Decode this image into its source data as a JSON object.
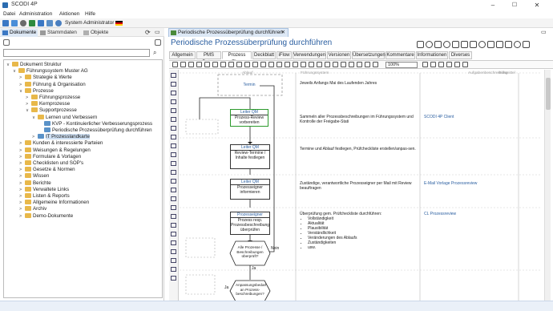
{
  "window": {
    "title": "SCODI 4P",
    "min": "–",
    "max": "☐",
    "close": "✕"
  },
  "menu": [
    "Datei",
    "Administration",
    "Aktionen",
    "Hilfe"
  ],
  "toolbar": {
    "user": "System Administrator"
  },
  "left": {
    "tabs": [
      "Dokumente",
      "Stammdaten",
      "Objekte"
    ],
    "search_placeholder": "",
    "tree": [
      {
        "label": "Dokument Struktur",
        "level": 0,
        "arrow": "∨",
        "type": "folder"
      },
      {
        "label": "Führungssystem Muster AG",
        "level": 1,
        "arrow": "∨",
        "type": "folder"
      },
      {
        "label": "Strategie & Werte",
        "level": 2,
        "arrow": ">",
        "type": "folder"
      },
      {
        "label": "Führung & Organisation",
        "level": 2,
        "arrow": ">",
        "type": "folder"
      },
      {
        "label": "Prozesse",
        "level": 2,
        "arrow": "∨",
        "type": "folder"
      },
      {
        "label": "Führungsprozesse",
        "level": 3,
        "arrow": ">",
        "type": "folder"
      },
      {
        "label": "Kernprozesse",
        "level": 3,
        "arrow": ">",
        "type": "folder"
      },
      {
        "label": "Supportprozesse",
        "level": 3,
        "arrow": "∨",
        "type": "folder"
      },
      {
        "label": "Lernen und Verbessern",
        "level": 4,
        "arrow": "∨",
        "type": "folder"
      },
      {
        "label": "KVP - Kontinuierlicher Verbesserungsprozess",
        "level": 5,
        "arrow": "",
        "type": "proc"
      },
      {
        "label": "Periodische Prozessüberprüfung durchführen",
        "level": 5,
        "arrow": "",
        "type": "proc"
      },
      {
        "label": "IT Prozesslandkarte",
        "level": 4,
        "arrow": ">",
        "type": "proc",
        "selected": true
      },
      {
        "label": "Kunden & interessierte Parteien",
        "level": 2,
        "arrow": ">",
        "type": "folder"
      },
      {
        "label": "Weisungen & Regelungen",
        "level": 2,
        "arrow": ">",
        "type": "folder"
      },
      {
        "label": "Formulare & Vorlagen",
        "level": 2,
        "arrow": ">",
        "type": "folder"
      },
      {
        "label": "Checklisten und SOP's",
        "level": 2,
        "arrow": ">",
        "type": "folder"
      },
      {
        "label": "Gesetze & Normen",
        "level": 2,
        "arrow": ">",
        "type": "folder"
      },
      {
        "label": "Wissen",
        "level": 2,
        "arrow": ">",
        "type": "folder"
      },
      {
        "label": "Berichte",
        "level": 2,
        "arrow": ">",
        "type": "folder"
      },
      {
        "label": "Verwaltete Links",
        "level": 2,
        "arrow": ">",
        "type": "folder"
      },
      {
        "label": "Listen & Reports",
        "level": 2,
        "arrow": ">",
        "type": "folder"
      },
      {
        "label": "Allgemeine Informationen",
        "level": 2,
        "arrow": ">",
        "type": "folder"
      },
      {
        "label": "Archiv",
        "level": 2,
        "arrow": ">",
        "type": "folder"
      },
      {
        "label": "Demo-Dokumente",
        "level": 2,
        "arrow": ">",
        "type": "folder"
      }
    ]
  },
  "right": {
    "doc_tab": "Periodische Prozessüberprüfung durchführen",
    "doc_title": "Periodische Prozessüberprüfung durchführen",
    "subtabs": [
      "Allgemein",
      "PMS Daten",
      "Prozess Flow",
      "Deckblatt",
      "iFlow",
      "Verwendungen",
      "Versionen",
      "Übersetzungen",
      "Kommentare",
      "Informationen",
      "Diverses"
    ],
    "active_subtab": "Prozess Flow",
    "zoom": "100%",
    "columns": [
      "Ablauf",
      "Führungssystem",
      "Aufgabenbeschreibung",
      "Hilfsmittel"
    ],
    "flow": {
      "start": "Termin",
      "steps": [
        {
          "role": "Leiter QM",
          "text": "Prozess-Review vorbereiten",
          "desc": "Sammeln aller Prozessbeschreibungen im Führungssystem und Kontrolle der Freigabe-Stati",
          "tool": "SCODI 4P Client"
        },
        {
          "role": "Leiter QM",
          "text": "Review-Termine / Inhalte festlegen",
          "desc": "Termine und Ablauf festlegen, Prüfcheckliste erstellen/anpas-sen.",
          "tool": ""
        },
        {
          "role": "Leiter QM",
          "text": "Prozesseigner informieren",
          "desc": "Zuständige, verantwortliche Prozesseigner per Mail mit Review beauftragen",
          "tool": "E-Mail Vorlage Prozessreview"
        },
        {
          "role": "Prozesseigner",
          "text": "Prozess resp. Prozessbeschreibung überprüfen",
          "desc": "Überprüfung gem. Prüfcheckliste durchführen:",
          "tool": "CL Prozessreview"
        }
      ],
      "start_desc": "Jeweils Anfangs Mai des Laufenden Jahres",
      "checklist": [
        "Vollständigkeit",
        "Aktualität",
        "Plausibilität",
        "Verständlichkeit",
        "Veränderungen des Ablaufs",
        "Zuständigkeiten",
        "usw."
      ],
      "decision1": "Alle Prozesse / Beschreibungen überprüft?",
      "decision1_no": "Nein",
      "decision1_yes": "Ja",
      "decision2": "Anpassungsbedarf an Prozess-beschreibungen?",
      "decision2_yes": "Ja"
    }
  }
}
